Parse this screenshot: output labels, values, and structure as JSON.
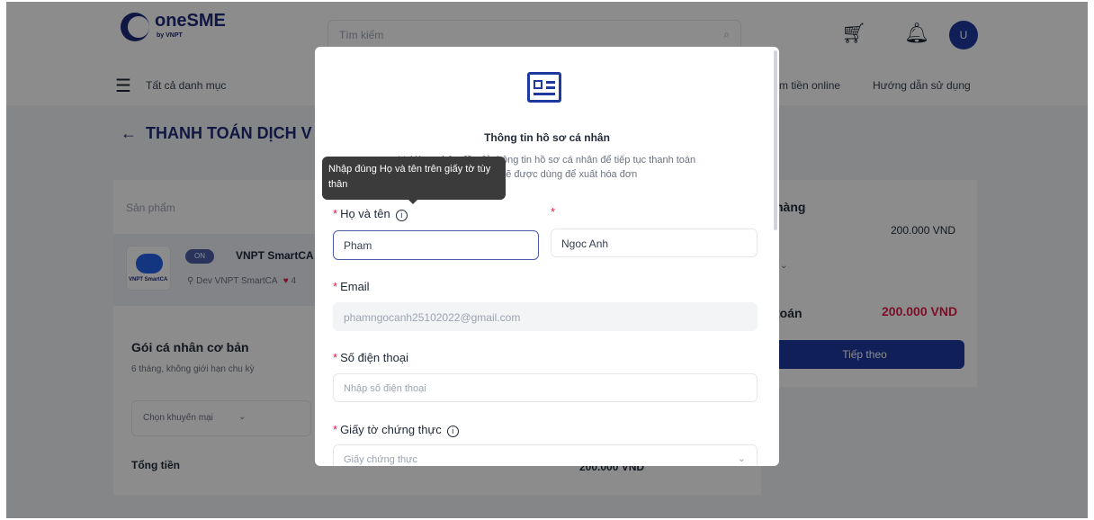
{
  "header": {
    "logo_text": "oneSME",
    "logo_sub": "by VNPT",
    "search_placeholder": "Tìm kiếm",
    "avatar_initial": "U"
  },
  "nav": {
    "all_categories": "Tất cả danh mục",
    "link_payment": "m tiền online",
    "link_guide": "Hướng dẫn sử dụng"
  },
  "page": {
    "title": "THANH TOÁN DỊCH V",
    "product_label": "Sản phẩm",
    "product": {
      "badge": "ON",
      "name": "VNPT SmartCA",
      "developer": "Dev VNPT SmartCA",
      "rating": "4",
      "image_text": "VNPT SmartCA"
    },
    "plan_name": "Gói cá nhân cơ bản",
    "plan_desc": "6 tháng, không giới hạn chu kỳ",
    "promo": "Chọn khuyến mại",
    "total_label": "Tổng tiền",
    "total_value": "200.000 VND"
  },
  "summary": {
    "title": "hàng",
    "price": "200.000 VND",
    "select_text": "i",
    "pay_label": "toán",
    "pay_value": "200.000 VND",
    "next_button": "Tiếp theo"
  },
  "modal": {
    "title": "Thông tin hồ sơ cá nhân",
    "desc_line1": "Vui lòng nhập đầy đủ thông tin hồ sơ cá nhân để tiếp tục thanh toán",
    "desc_line2": "Thông tin sẽ được dùng để xuất hóa đơn",
    "tooltip": "Nhập đúng Họ và tên trên giấy tờ tùy thân",
    "fullname_label": "Họ và tên",
    "last_name_value": "Pham",
    "first_name_value": "Ngoc Anh",
    "email_label": "Email",
    "email_value": "phamngocanh25102022@gmail.com",
    "phone_label": "Số điện thoại",
    "phone_placeholder": "Nhập số điện thoại",
    "id_label": "Giấy tờ chứng thực",
    "id_placeholder": "Giấy chứng thực"
  }
}
